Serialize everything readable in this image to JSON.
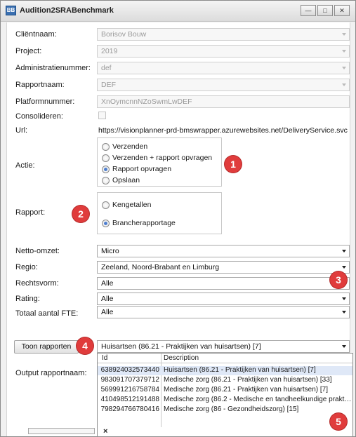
{
  "window": {
    "title": "Audition2SRABenchmark",
    "icon_text": "BB",
    "controls": [
      "minimize-icon",
      "maximize-icon",
      "close-icon"
    ]
  },
  "form": {
    "clientnaam": {
      "label": "Cliëntnaam:",
      "value": "Borisov Bouw"
    },
    "project": {
      "label": "Project:",
      "value": "2019"
    },
    "administratienummer": {
      "label": "Administratienummer:",
      "value": "def"
    },
    "rapportnaam": {
      "label": "Rapportnaam:",
      "value": "DEF"
    },
    "platformnummer": {
      "label": "Platformnummer:",
      "value": "XnOymcnnNZoSwmLwDEF"
    },
    "consolideren": {
      "label": "Consolideren:",
      "checked": false
    },
    "url": {
      "label": "Url:",
      "value": "https://visionplanner-prd-bmswrapper.azurewebsites.net/DeliveryService.svc"
    }
  },
  "actie": {
    "label": "Actie:",
    "options": [
      {
        "label": "Verzenden",
        "selected": false
      },
      {
        "label": "Verzenden + rapport opvragen",
        "selected": false
      },
      {
        "label": "Rapport opvragen",
        "selected": true
      },
      {
        "label": "Opslaan",
        "selected": false
      }
    ]
  },
  "rapport": {
    "label": "Rapport:",
    "options": [
      {
        "label": "Kengetallen",
        "selected": false
      },
      {
        "label": "Brancherapportage",
        "selected": true
      }
    ]
  },
  "filters": {
    "netto_omzet": {
      "label": "Netto-omzet:",
      "value": "Micro"
    },
    "regio": {
      "label": "Regio:",
      "value": "Zeeland, Noord-Brabant en Limburg"
    },
    "rechtsvorm": {
      "label": "Rechtsvorm:",
      "value": "Alle"
    },
    "rating": {
      "label": "Rating:",
      "value": "Alle"
    },
    "totaal_fte": {
      "label": "Totaal aantal FTE:",
      "value": "Alle"
    }
  },
  "rapporten": {
    "button_label": "Toon rapporten",
    "selected_value": "Huisartsen (86.21 - Praktijken van huisartsen) [7]",
    "output_label": "Output rapportnaam:",
    "columns": {
      "id": "Id",
      "description": "Description"
    },
    "rows": [
      {
        "id": "638924032573440",
        "description": "Huisartsen (86.21 - Praktijken van huisartsen) [7]"
      },
      {
        "id": "983091707379712",
        "description": "Medische zorg (86.21 - Praktijken van huisartsen) [33]"
      },
      {
        "id": "569991216758784",
        "description": "Medische zorg (86.21 - Praktijken van huisartsen) [7]"
      },
      {
        "id": "410498512191488",
        "description": "Medische zorg (86.2 - Medische en tandheelkundige praktijk..."
      },
      {
        "id": "798294766780416",
        "description": "Medische zorg (86 - Gezondheidszorg) [15]"
      }
    ],
    "close_glyph": "×"
  },
  "callouts": [
    "1",
    "2",
    "3",
    "4",
    "5"
  ],
  "colors": {
    "callout": "#e03c3c",
    "selection": "#dfe8f7"
  }
}
